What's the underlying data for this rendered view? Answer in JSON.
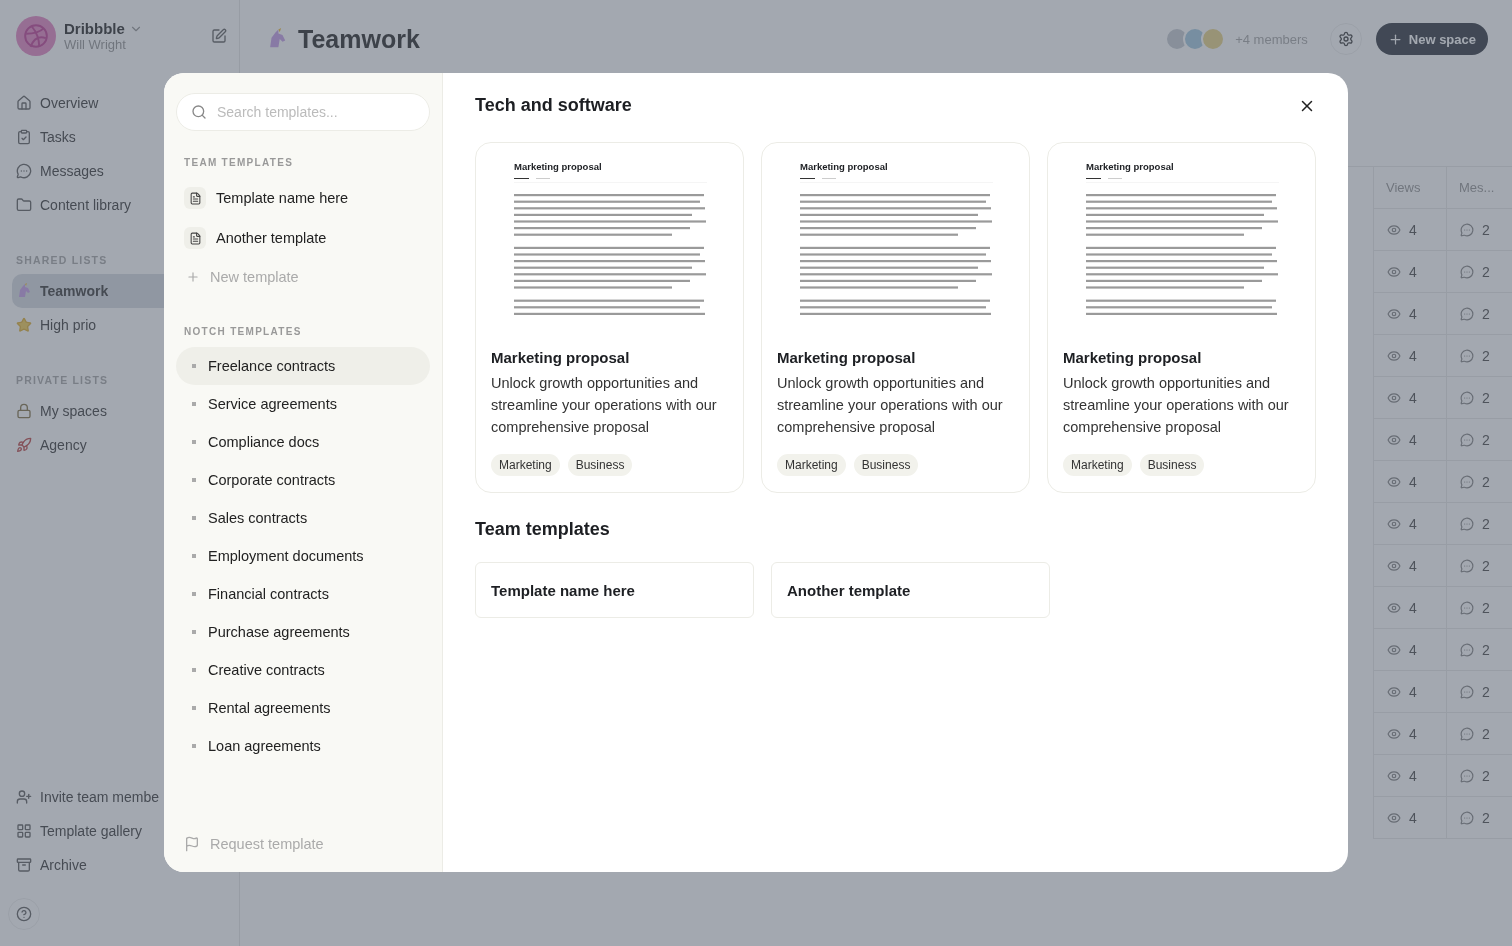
{
  "app": {
    "workspace": "Dribbble",
    "user": "Will Wright",
    "nav": [
      {
        "label": "Overview"
      },
      {
        "label": "Tasks"
      },
      {
        "label": "Messages"
      },
      {
        "label": "Content library"
      }
    ],
    "shared_heading": "SHARED LISTS",
    "shared_lists": [
      {
        "label": "Teamwork",
        "selected": true
      },
      {
        "label": "High prio",
        "selected": false
      }
    ],
    "private_heading": "PRIVATE LISTS",
    "private_lists": [
      {
        "label": "My spaces",
        "selected": false
      },
      {
        "label": "Agency",
        "selected": false
      }
    ],
    "footer_links": [
      {
        "label": "Invite team membe"
      },
      {
        "label": "Template gallery"
      },
      {
        "label": "Archive"
      }
    ],
    "title": "Teamwork",
    "members": "+4 members",
    "new_space": "New space",
    "table": {
      "columns": [
        "Views",
        "Mes..."
      ],
      "rows": [
        {
          "views": "4",
          "messages": "2"
        },
        {
          "views": "4",
          "messages": "2"
        },
        {
          "views": "4",
          "messages": "2"
        },
        {
          "views": "4",
          "messages": "2"
        },
        {
          "views": "4",
          "messages": "2"
        },
        {
          "views": "4",
          "messages": "2"
        },
        {
          "views": "4",
          "messages": "2"
        },
        {
          "views": "4",
          "messages": "2"
        },
        {
          "views": "4",
          "messages": "2"
        },
        {
          "views": "4",
          "messages": "2"
        },
        {
          "views": "4",
          "messages": "2"
        },
        {
          "views": "4",
          "messages": "2"
        },
        {
          "views": "4",
          "messages": "2"
        },
        {
          "views": "4",
          "messages": "2"
        },
        {
          "views": "4",
          "messages": "2"
        }
      ]
    }
  },
  "modal": {
    "search": {
      "placeholder": "Search templates..."
    },
    "team_heading": "TEAM TEMPLATES",
    "team_templates": [
      {
        "label": "Template name here"
      },
      {
        "label": "Another template"
      }
    ],
    "new_template": "New template",
    "notch_heading": "NOTCH TEMPLATES",
    "notch_templates": [
      {
        "label": "Freelance contracts",
        "selected": true
      },
      {
        "label": "Service agreements",
        "selected": false
      },
      {
        "label": "Compliance docs",
        "selected": false
      },
      {
        "label": "Corporate contracts",
        "selected": false
      },
      {
        "label": "Sales contracts",
        "selected": false
      },
      {
        "label": "Employment documents",
        "selected": false
      },
      {
        "label": "Financial contracts",
        "selected": false
      },
      {
        "label": "Purchase agreements",
        "selected": false
      },
      {
        "label": "Creative contracts",
        "selected": false
      },
      {
        "label": "Rental agreements",
        "selected": false
      },
      {
        "label": "Loan agreements",
        "selected": false
      }
    ],
    "request_template": "Request template",
    "section_title": "Tech and software",
    "cards": [
      {
        "preview": {
          "title": "Marketing proposal"
        },
        "title": "Marketing proposal",
        "description": "Unlock growth opportunities and streamline your operations with our comprehensive proposal",
        "tags": [
          "Marketing",
          "Business"
        ]
      },
      {
        "preview": {
          "title": "Marketing proposal"
        },
        "title": "Marketing proposal",
        "description": "Unlock growth opportunities and streamline your operations with our comprehensive proposal",
        "tags": [
          "Marketing",
          "Business"
        ]
      },
      {
        "preview": {
          "title": "Marketing proposal"
        },
        "title": "Marketing proposal",
        "description": "Unlock growth opportunities and streamline your operations with our comprehensive proposal",
        "tags": [
          "Marketing",
          "Business"
        ]
      }
    ],
    "team_section_title": "Team templates",
    "team_cards": [
      {
        "title": "Template name here"
      },
      {
        "title": "Another template"
      }
    ]
  }
}
